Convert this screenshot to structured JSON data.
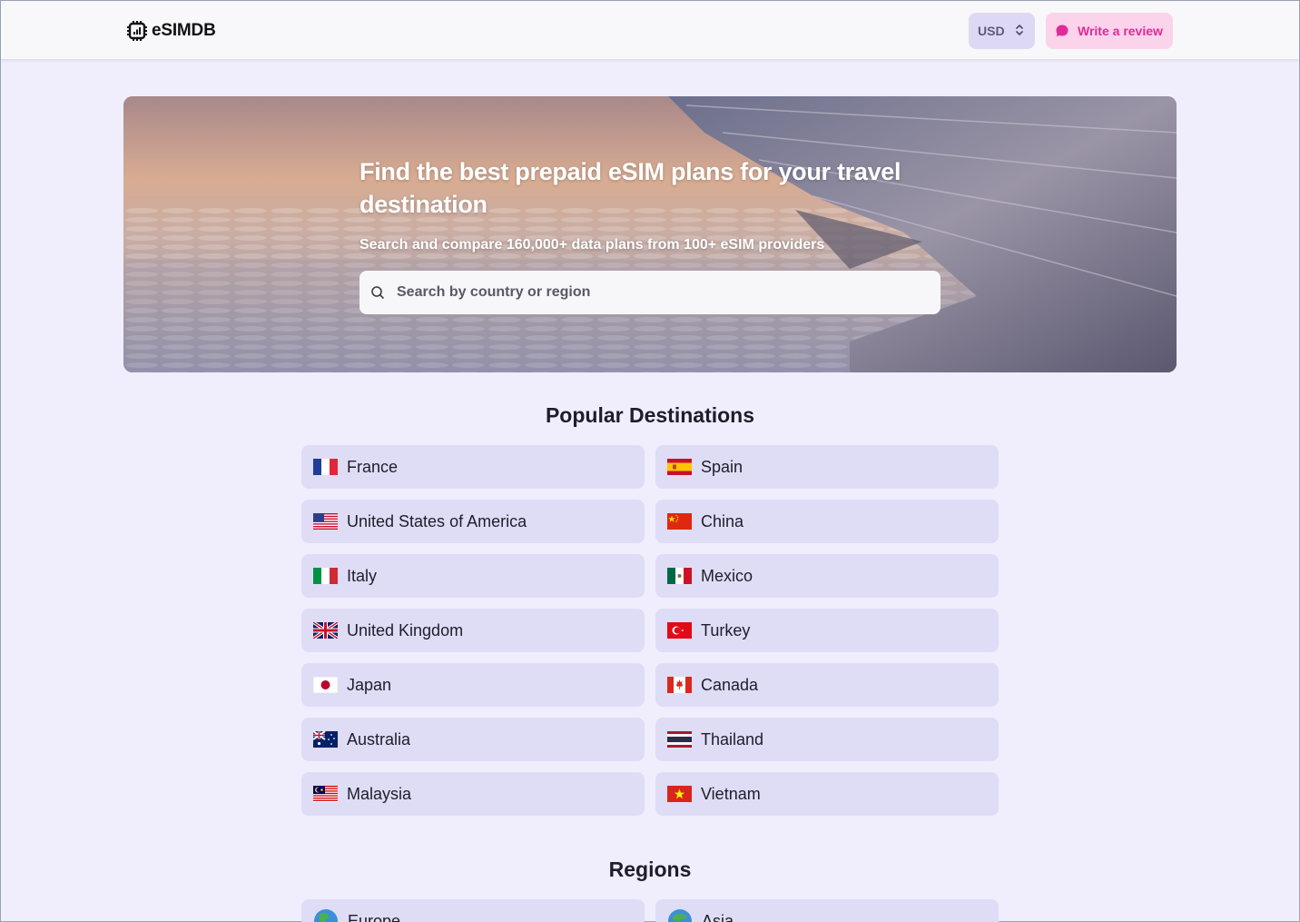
{
  "brand": {
    "name": "eSIMDB",
    "logo_icon": "chip-icon"
  },
  "header": {
    "currency": "USD",
    "review_label": "Write a review",
    "colors": {
      "review_bg": "#fbd3ea",
      "review_text": "#e12a9a",
      "currency_bg": "#ddd9f5"
    }
  },
  "hero": {
    "title": "Find the best prepaid eSIM plans for your travel destination",
    "subtitle": "Search and compare 160,000+ data plans from 100+ eSIM providers",
    "search_placeholder": "Search by country or region"
  },
  "popular": {
    "title": "Popular Destinations",
    "items": [
      {
        "label": "France",
        "flag": "flag-fr"
      },
      {
        "label": "Spain",
        "flag": "flag-es"
      },
      {
        "label": "United States of America",
        "flag": "flag-us"
      },
      {
        "label": "China",
        "flag": "flag-cn"
      },
      {
        "label": "Italy",
        "flag": "flag-it"
      },
      {
        "label": "Mexico",
        "flag": "flag-mx"
      },
      {
        "label": "United Kingdom",
        "flag": "flag-gb"
      },
      {
        "label": "Turkey",
        "flag": "flag-tr"
      },
      {
        "label": "Japan",
        "flag": "flag-jp"
      },
      {
        "label": "Canada",
        "flag": "flag-ca"
      },
      {
        "label": "Australia",
        "flag": "flag-au"
      },
      {
        "label": "Thailand",
        "flag": "flag-th"
      },
      {
        "label": "Malaysia",
        "flag": "flag-my"
      },
      {
        "label": "Vietnam",
        "flag": "flag-vn"
      }
    ]
  },
  "regions": {
    "title": "Regions",
    "items": [
      {
        "label": "Europe",
        "icon": "globe-europe-icon"
      },
      {
        "label": "Asia",
        "icon": "globe-asia-icon"
      }
    ]
  }
}
